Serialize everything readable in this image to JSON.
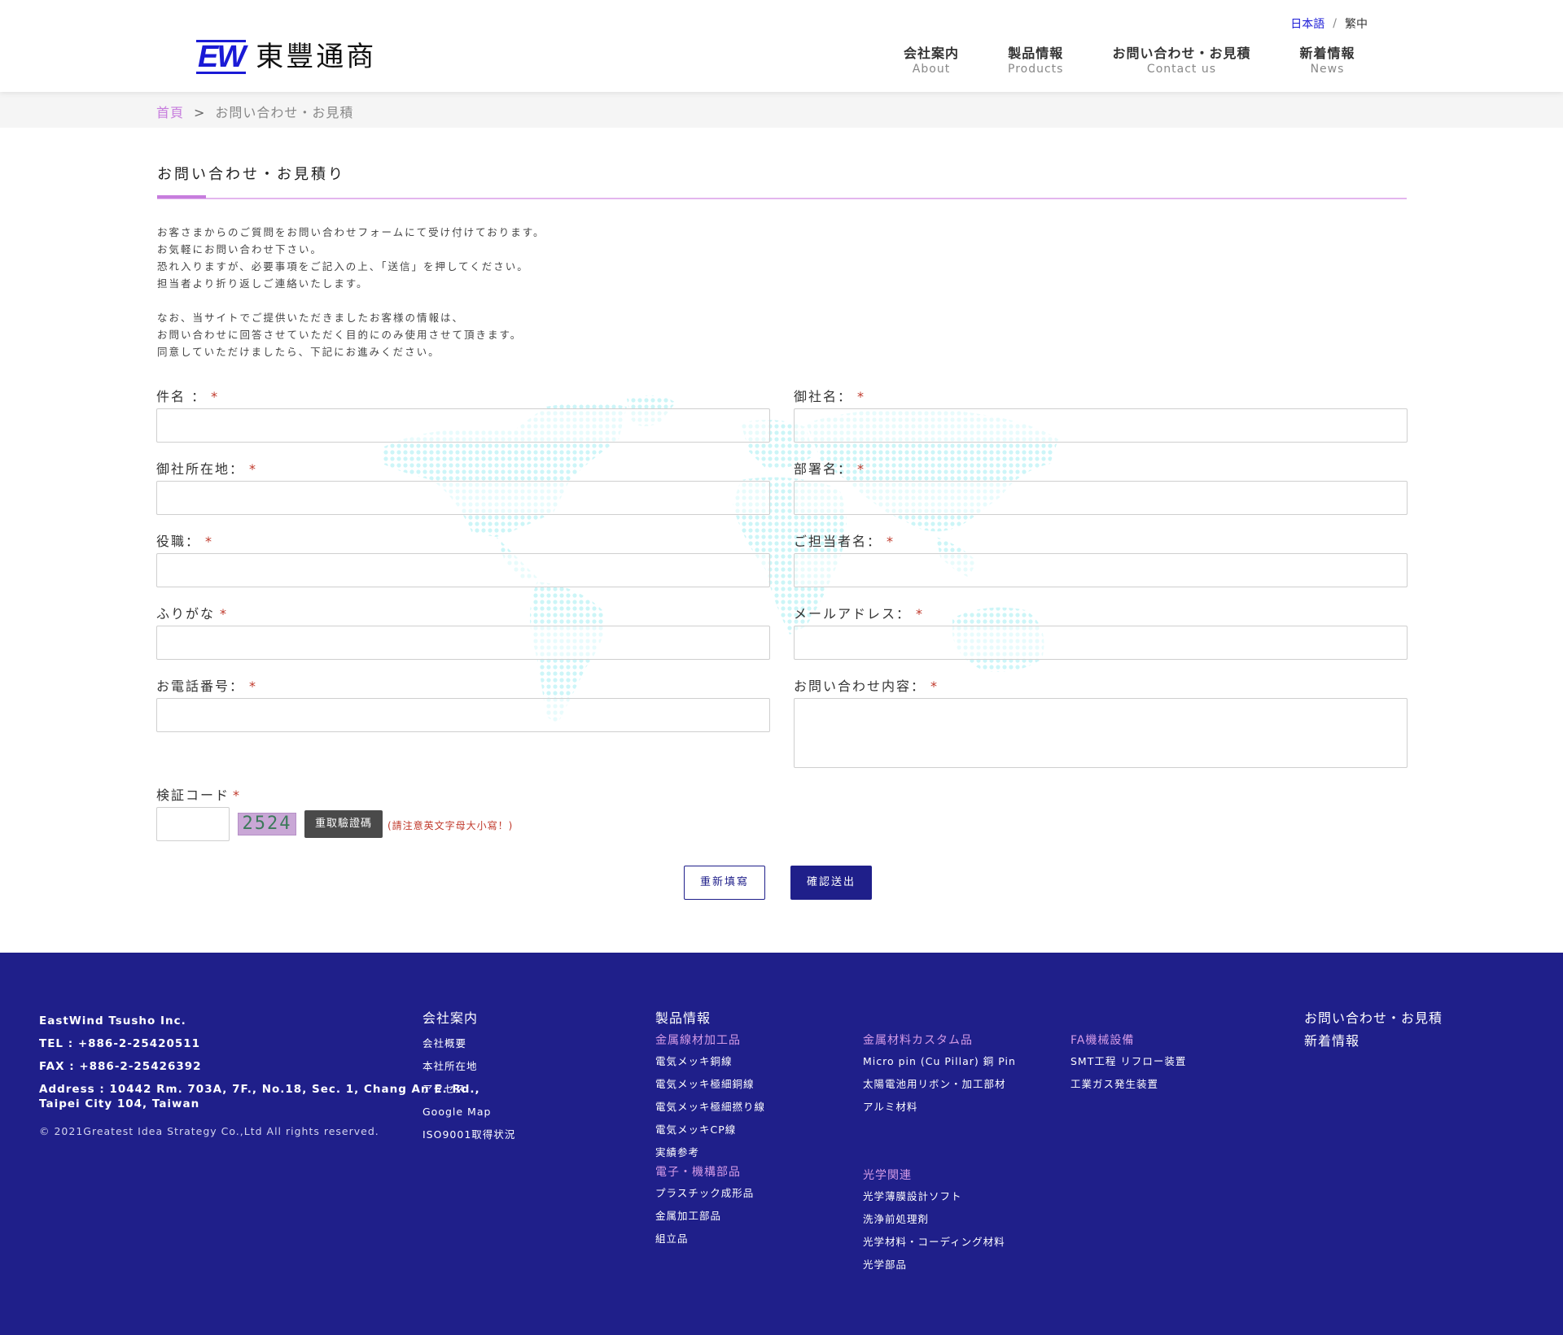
{
  "header": {
    "logo_mark": "EW",
    "logo_text": "東豐通商",
    "lang": {
      "ja": "日本語",
      "sep": "/",
      "zh": "繁中"
    },
    "nav": [
      {
        "jp": "会社案内",
        "en": "About"
      },
      {
        "jp": "製品情報",
        "en": "Products"
      },
      {
        "jp": "お問い合わせ・お見積",
        "en": "Contact us"
      },
      {
        "jp": "新着情報",
        "en": "News"
      }
    ]
  },
  "breadcrumb": {
    "home": "首頁",
    "separator": ">",
    "current": "お問い合わせ・お見積"
  },
  "page": {
    "title": "お問い合わせ・お見積り",
    "intro_lines_1": [
      "お客さまからのご質問をお問い合わせフォームにて受け付けております。",
      "お気軽にお問い合わせ下さい。",
      "恐れ入りますが、必要事項をご記入の上、「送信」を押してください。",
      "担当者より折り返しご連絡いたします。"
    ],
    "intro_lines_2": [
      "なお、当サイトでご提供いただきましたお客様の情報は、",
      "お問い合わせに回答させていただく目的にのみ使用させて頂きます。",
      "同意していただけましたら、下記にお進みください。"
    ]
  },
  "form": {
    "required_mark": "*",
    "fields": {
      "subject": "件名 ：",
      "company": "御社名：",
      "address": "御社所在地：",
      "department": "部署名：",
      "position": "役職：",
      "contact_name": "ご担当者名：",
      "furigana": "ふりがな",
      "email": "メールアドレス：",
      "phone": "お電話番号：",
      "inquiry": "お問い合わせ内容："
    },
    "captcha": {
      "label": "検証コード",
      "code": "2524",
      "refresh": "重取驗證碼",
      "note": "(請注意英文字母大小寫！)"
    },
    "reset_label": "重新填寫",
    "submit_label": "確認送出"
  },
  "footer": {
    "company": {
      "name": "EastWind Tsusho Inc.",
      "tel": "TEL : +886-2-25420511",
      "fax": "FAX : +886-2-25426392",
      "address_1": "Address : 10442 Rm. 703A, 7F., No.18, Sec. 1, Chang An E. Rd.,",
      "address_2": "Taipei City 104, Taiwan",
      "copyright": "© 2021Greatest Idea Strategy Co.,Ltd All rights reserved."
    },
    "about": {
      "heading": "会社案内",
      "links": [
        "会社概要",
        "本社所在地",
        "アクセス",
        "Google Map",
        "ISO9001取得状況"
      ]
    },
    "products": {
      "heading": "製品情報",
      "wire": {
        "title": "金属線材加工品",
        "links": [
          "電気メッキ銅線",
          "電気メッキ極細銅線",
          "電気メッキ極細撚り線",
          "電気メッキCP線",
          "実績参考"
        ]
      },
      "electronic": {
        "title": "電子・機構部品",
        "links": [
          "プラスチック成形品",
          "金属加工部品",
          "組立品"
        ]
      },
      "material": {
        "title": "金属材料カスタム品",
        "links": [
          "Micro pin (Cu Pillar) 銅 Pin",
          "太陽電池用リボン・加工部材",
          "アルミ材料"
        ]
      },
      "optical": {
        "title": "光学関連",
        "links": [
          "光学薄膜設計ソフト",
          "洗浄前処理剤",
          "光学材料・コーディング材料",
          "光学部品"
        ]
      },
      "fa": {
        "title": "FA機械設備",
        "links": [
          "SMT工程 リフロー装置",
          "工業ガス発生装置"
        ]
      }
    },
    "right": {
      "contact": "お問い合わせ・お見積",
      "news": "新着情報"
    }
  },
  "colors": {
    "brand_navy": "#1f1f8a",
    "accent_purple": "#c77ddd",
    "required_red": "#c0392b",
    "logo_blue": "#1a1ad6"
  }
}
